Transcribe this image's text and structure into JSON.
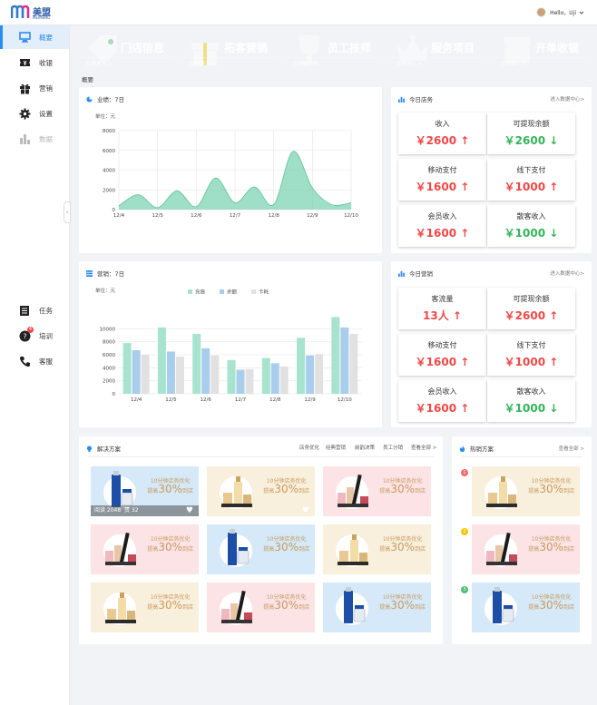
{
  "header": {
    "logo_text": "美盟",
    "logo_sub": "MEIMENG",
    "user_greeting": "Hello，Uji"
  },
  "sidebar": {
    "items": [
      {
        "label": "概要",
        "icon": "monitor-icon"
      },
      {
        "label": "收银",
        "icon": "ticket-icon"
      },
      {
        "label": "营销",
        "icon": "gift-icon"
      },
      {
        "label": "设置",
        "icon": "gear-icon"
      },
      {
        "label": "数据",
        "icon": "bar-chart-icon"
      }
    ],
    "bottom_items": [
      {
        "label": "任务",
        "icon": "task-icon"
      },
      {
        "label": "培训",
        "icon": "question-icon",
        "badge": "4"
      },
      {
        "label": "客服",
        "icon": "phone-icon"
      }
    ],
    "collapse_glyph": "‹"
  },
  "tiles": [
    {
      "title": "门店信息",
      "sub": "立即进入 >",
      "color": "#4dc074"
    },
    {
      "title": "拓客营销",
      "sub": "立即进入 >",
      "color": "#f7c600"
    },
    {
      "title": "员工技师",
      "sub": "立即进入 >",
      "color": "#9b58b6"
    },
    {
      "title": "服务项目",
      "sub": "立即进入 >",
      "color": "#2d9be3"
    },
    {
      "title": "开单收银",
      "sub": "立即进入 >",
      "color": "#f26a6b"
    }
  ],
  "section_label": "概要",
  "performance": {
    "title": "业绩：7日",
    "unit": "单位：元"
  },
  "marketing": {
    "title": "营销：7日",
    "unit": "单位：元"
  },
  "today_finance": {
    "title": "今日店务",
    "link": "进入数据中心>",
    "stats": [
      {
        "label": "收入",
        "value": "￥2600",
        "arrow": "↑",
        "trend": "up"
      },
      {
        "label": "可提现余额",
        "value": "￥2600",
        "arrow": "↓",
        "trend": "down"
      },
      {
        "label": "移动支付",
        "value": "￥1600",
        "arrow": "↑",
        "trend": "up"
      },
      {
        "label": "线下支付",
        "value": "￥1000",
        "arrow": "↑",
        "trend": "up"
      },
      {
        "label": "会员收入",
        "value": "￥1600",
        "arrow": "↑",
        "trend": "up"
      },
      {
        "label": "散客收入",
        "value": "￥1000",
        "arrow": "↓",
        "trend": "down"
      }
    ]
  },
  "today_marketing": {
    "title": "今日营销",
    "link": "进入数据中心>",
    "stats": [
      {
        "label": "客流量",
        "value": "13人",
        "arrow": "↑",
        "trend": "up"
      },
      {
        "label": "可提现余额",
        "value": "￥2600",
        "arrow": "↑",
        "trend": "up"
      },
      {
        "label": "移动支付",
        "value": "￥1600",
        "arrow": "↑",
        "trend": "up"
      },
      {
        "label": "线下支付",
        "value": "￥1000",
        "arrow": "↑",
        "trend": "up"
      },
      {
        "label": "会员收入",
        "value": "￥1600",
        "arrow": "↑",
        "trend": "up"
      },
      {
        "label": "散客收入",
        "value": "￥1000",
        "arrow": "↓",
        "trend": "down"
      }
    ]
  },
  "solutions": {
    "title": "解决方案",
    "tabs": [
      "店务优化",
      "经典营销",
      "前韵决策",
      "员工分销",
      "查看全部 >"
    ],
    "card_line1": "10分钟店务优化",
    "card_line2_prefix": "提高",
    "card_line2_num": "30%",
    "card_line2_suffix": "到店",
    "views": "阅读 2048",
    "likes": "赞 32"
  },
  "plans": {
    "title": "热销方案",
    "more": "查看全部 >",
    "steps": [
      "1",
      "2",
      "3"
    ]
  },
  "colors": {
    "accent": "#2d8cf0",
    "up": "#f04848",
    "down": "#34b55a",
    "area": "#7fd3b4",
    "bar_teal": "#a8e3cf",
    "bar_blue": "#a9cdec",
    "bar_grey": "#e1e1e1"
  },
  "chart_data": [
    {
      "type": "area",
      "title": "业绩：7日",
      "ylabel": "单位：元",
      "categories": [
        "12/4",
        "12/5",
        "12/6",
        "12/7",
        "12/8",
        "12/9",
        "12/10"
      ],
      "x_points": [
        "12/4",
        "",
        "12/5",
        "",
        "12/6",
        "",
        "12/7",
        "",
        "12/8",
        "",
        "12/9",
        "",
        "12/10"
      ],
      "values": [
        400,
        1500,
        200,
        1900,
        300,
        3200,
        700,
        2300,
        500,
        5900,
        2200,
        500,
        700
      ],
      "ylim": [
        0,
        8000
      ],
      "yticks": [
        0,
        2000,
        4000,
        6000,
        8000
      ],
      "grid": true
    },
    {
      "type": "bar",
      "title": "营销：7日",
      "ylabel": "单位：元",
      "categories": [
        "12/4",
        "12/5",
        "12/6",
        "12/7",
        "12/8",
        "12/9",
        "12/10"
      ],
      "series": [
        {
          "name": "充值",
          "values": [
            7800,
            10200,
            9200,
            5200,
            5500,
            8600,
            11800
          ]
        },
        {
          "name": "余额",
          "values": [
            6700,
            6500,
            7000,
            3700,
            4700,
            5900,
            10200
          ]
        },
        {
          "name": "卡耗",
          "values": [
            6000,
            5700,
            5900,
            3800,
            4200,
            6100,
            9200
          ]
        }
      ],
      "ylim": [
        0,
        12000
      ],
      "yticks": [
        0,
        2000,
        4000,
        6000,
        8000,
        10000
      ],
      "legend": "top",
      "grid": true
    }
  ]
}
